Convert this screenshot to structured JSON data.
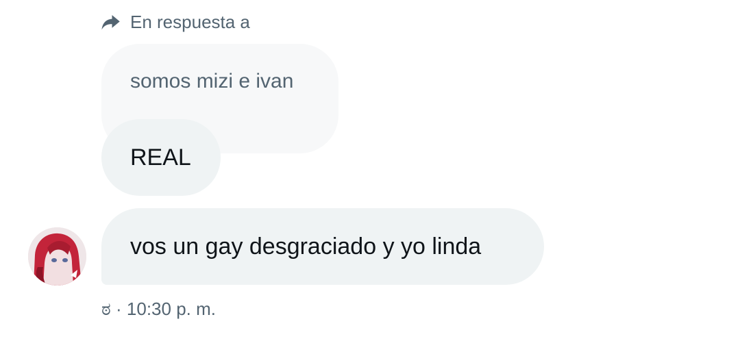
{
  "reply_header": {
    "label": "En respuesta a",
    "icon": "reply-arrow-icon"
  },
  "messages": [
    {
      "text": "somos mizi e ivan",
      "kind": "quoted"
    },
    {
      "text": "REAL",
      "kind": "reply"
    },
    {
      "text": "vos un gay desgraciado y yo linda",
      "kind": "reply"
    }
  ],
  "meta": {
    "reaction": "ಠ",
    "separator": "·",
    "time": "10:30 p. m."
  },
  "colors": {
    "bubble": "#eff3f4",
    "quoted_bubble": "#f7f8f9",
    "text_primary": "#0f1419",
    "text_secondary": "#536471"
  }
}
